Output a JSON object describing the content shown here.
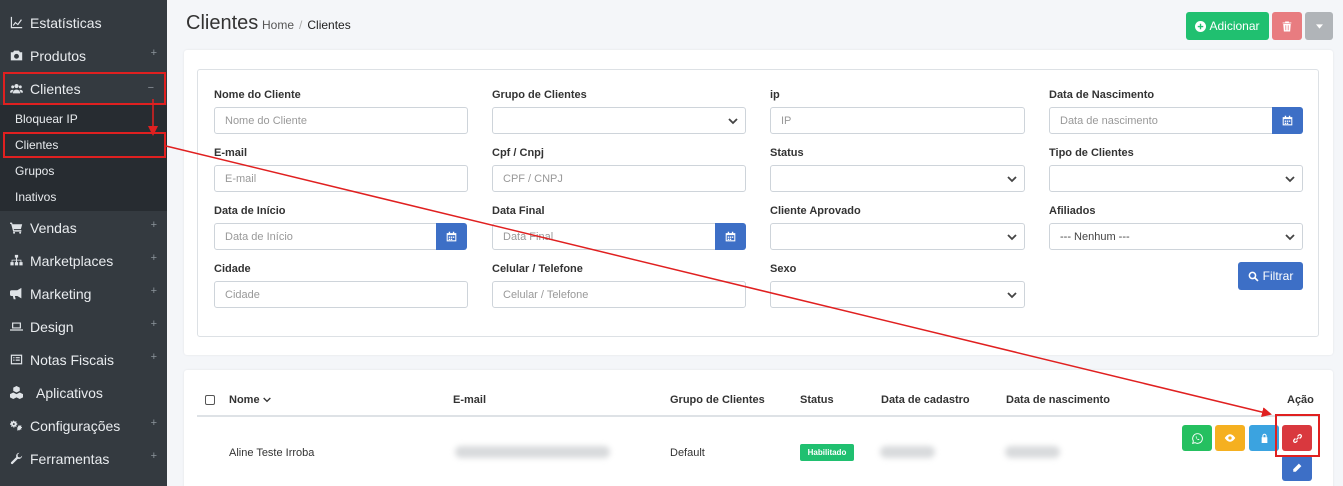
{
  "sidebar": {
    "items_top": [
      {
        "label": "Estatísticas",
        "icon": "chart-line-icon",
        "expand": ""
      },
      {
        "label": "Produtos",
        "icon": "camera-icon",
        "expand": "+"
      }
    ],
    "active_item": {
      "label": "Clientes",
      "icon": "users-icon",
      "expand": "−"
    },
    "submenu": [
      "Bloquear IP",
      "Clientes",
      "Grupos",
      "Inativos"
    ],
    "items_bottom": [
      {
        "label": "Vendas",
        "icon": "cart-icon",
        "expand": "+"
      },
      {
        "label": "Marketplaces",
        "icon": "sitemap-icon",
        "expand": "+"
      },
      {
        "label": "Marketing",
        "icon": "bullhorn-icon",
        "expand": "+"
      },
      {
        "label": "Design",
        "icon": "laptop-icon",
        "expand": "+"
      },
      {
        "label": "Notas Fiscais",
        "icon": "list-icon",
        "expand": "+"
      },
      {
        "label": "Aplicativos",
        "icon": "cubes-icon",
        "expand": ""
      },
      {
        "label": "Configurações",
        "icon": "cogs-icon",
        "expand": "+"
      },
      {
        "label": "Ferramentas",
        "icon": "wrench-icon",
        "expand": "+"
      }
    ]
  },
  "header": {
    "title": "Clientes",
    "breadcrumb_home": "Home",
    "breadcrumb_sep": "/",
    "breadcrumb_current": "Clientes",
    "add_label": "Adicionar"
  },
  "filters": {
    "nome_label": "Nome do Cliente",
    "nome_placeholder": "Nome do Cliente",
    "grupo_label": "Grupo de Clientes",
    "ip_label": "ip",
    "ip_placeholder": "IP",
    "nasc_label": "Data de Nascimento",
    "nasc_placeholder": "Data de nascimento",
    "email_label": "E-mail",
    "email_placeholder": "E-mail",
    "cpf_label": "Cpf / Cnpj",
    "cpf_placeholder": "CPF / CNPJ",
    "status_label": "Status",
    "tipo_label": "Tipo de Clientes",
    "inicio_label": "Data de Início",
    "inicio_placeholder": "Data de Início",
    "final_label": "Data Final",
    "final_placeholder": "Data Final",
    "aprovado_label": "Cliente Aprovado",
    "afiliados_label": "Afiliados",
    "afiliados_value": "--- Nenhum ---",
    "cidade_label": "Cidade",
    "cidade_placeholder": "Cidade",
    "celular_label": "Celular / Telefone",
    "celular_placeholder": "Celular / Telefone",
    "sexo_label": "Sexo",
    "filter_button": "Filtrar"
  },
  "table": {
    "columns": [
      "Nome",
      "E-mail",
      "Grupo de Clientes",
      "Status",
      "Data de cadastro",
      "Data de nascimento",
      "Ação"
    ],
    "rows": [
      {
        "nome": "Aline Teste Irroba",
        "grupo": "Default",
        "status": "Habilitado"
      }
    ]
  },
  "colors": {
    "sidebar": "#343a40",
    "success": "#20c070",
    "primary": "#3d6fc6",
    "danger": "#d9383e",
    "warning": "#f5b020",
    "info": "#3ba3e0",
    "annotation": "#e02020"
  }
}
